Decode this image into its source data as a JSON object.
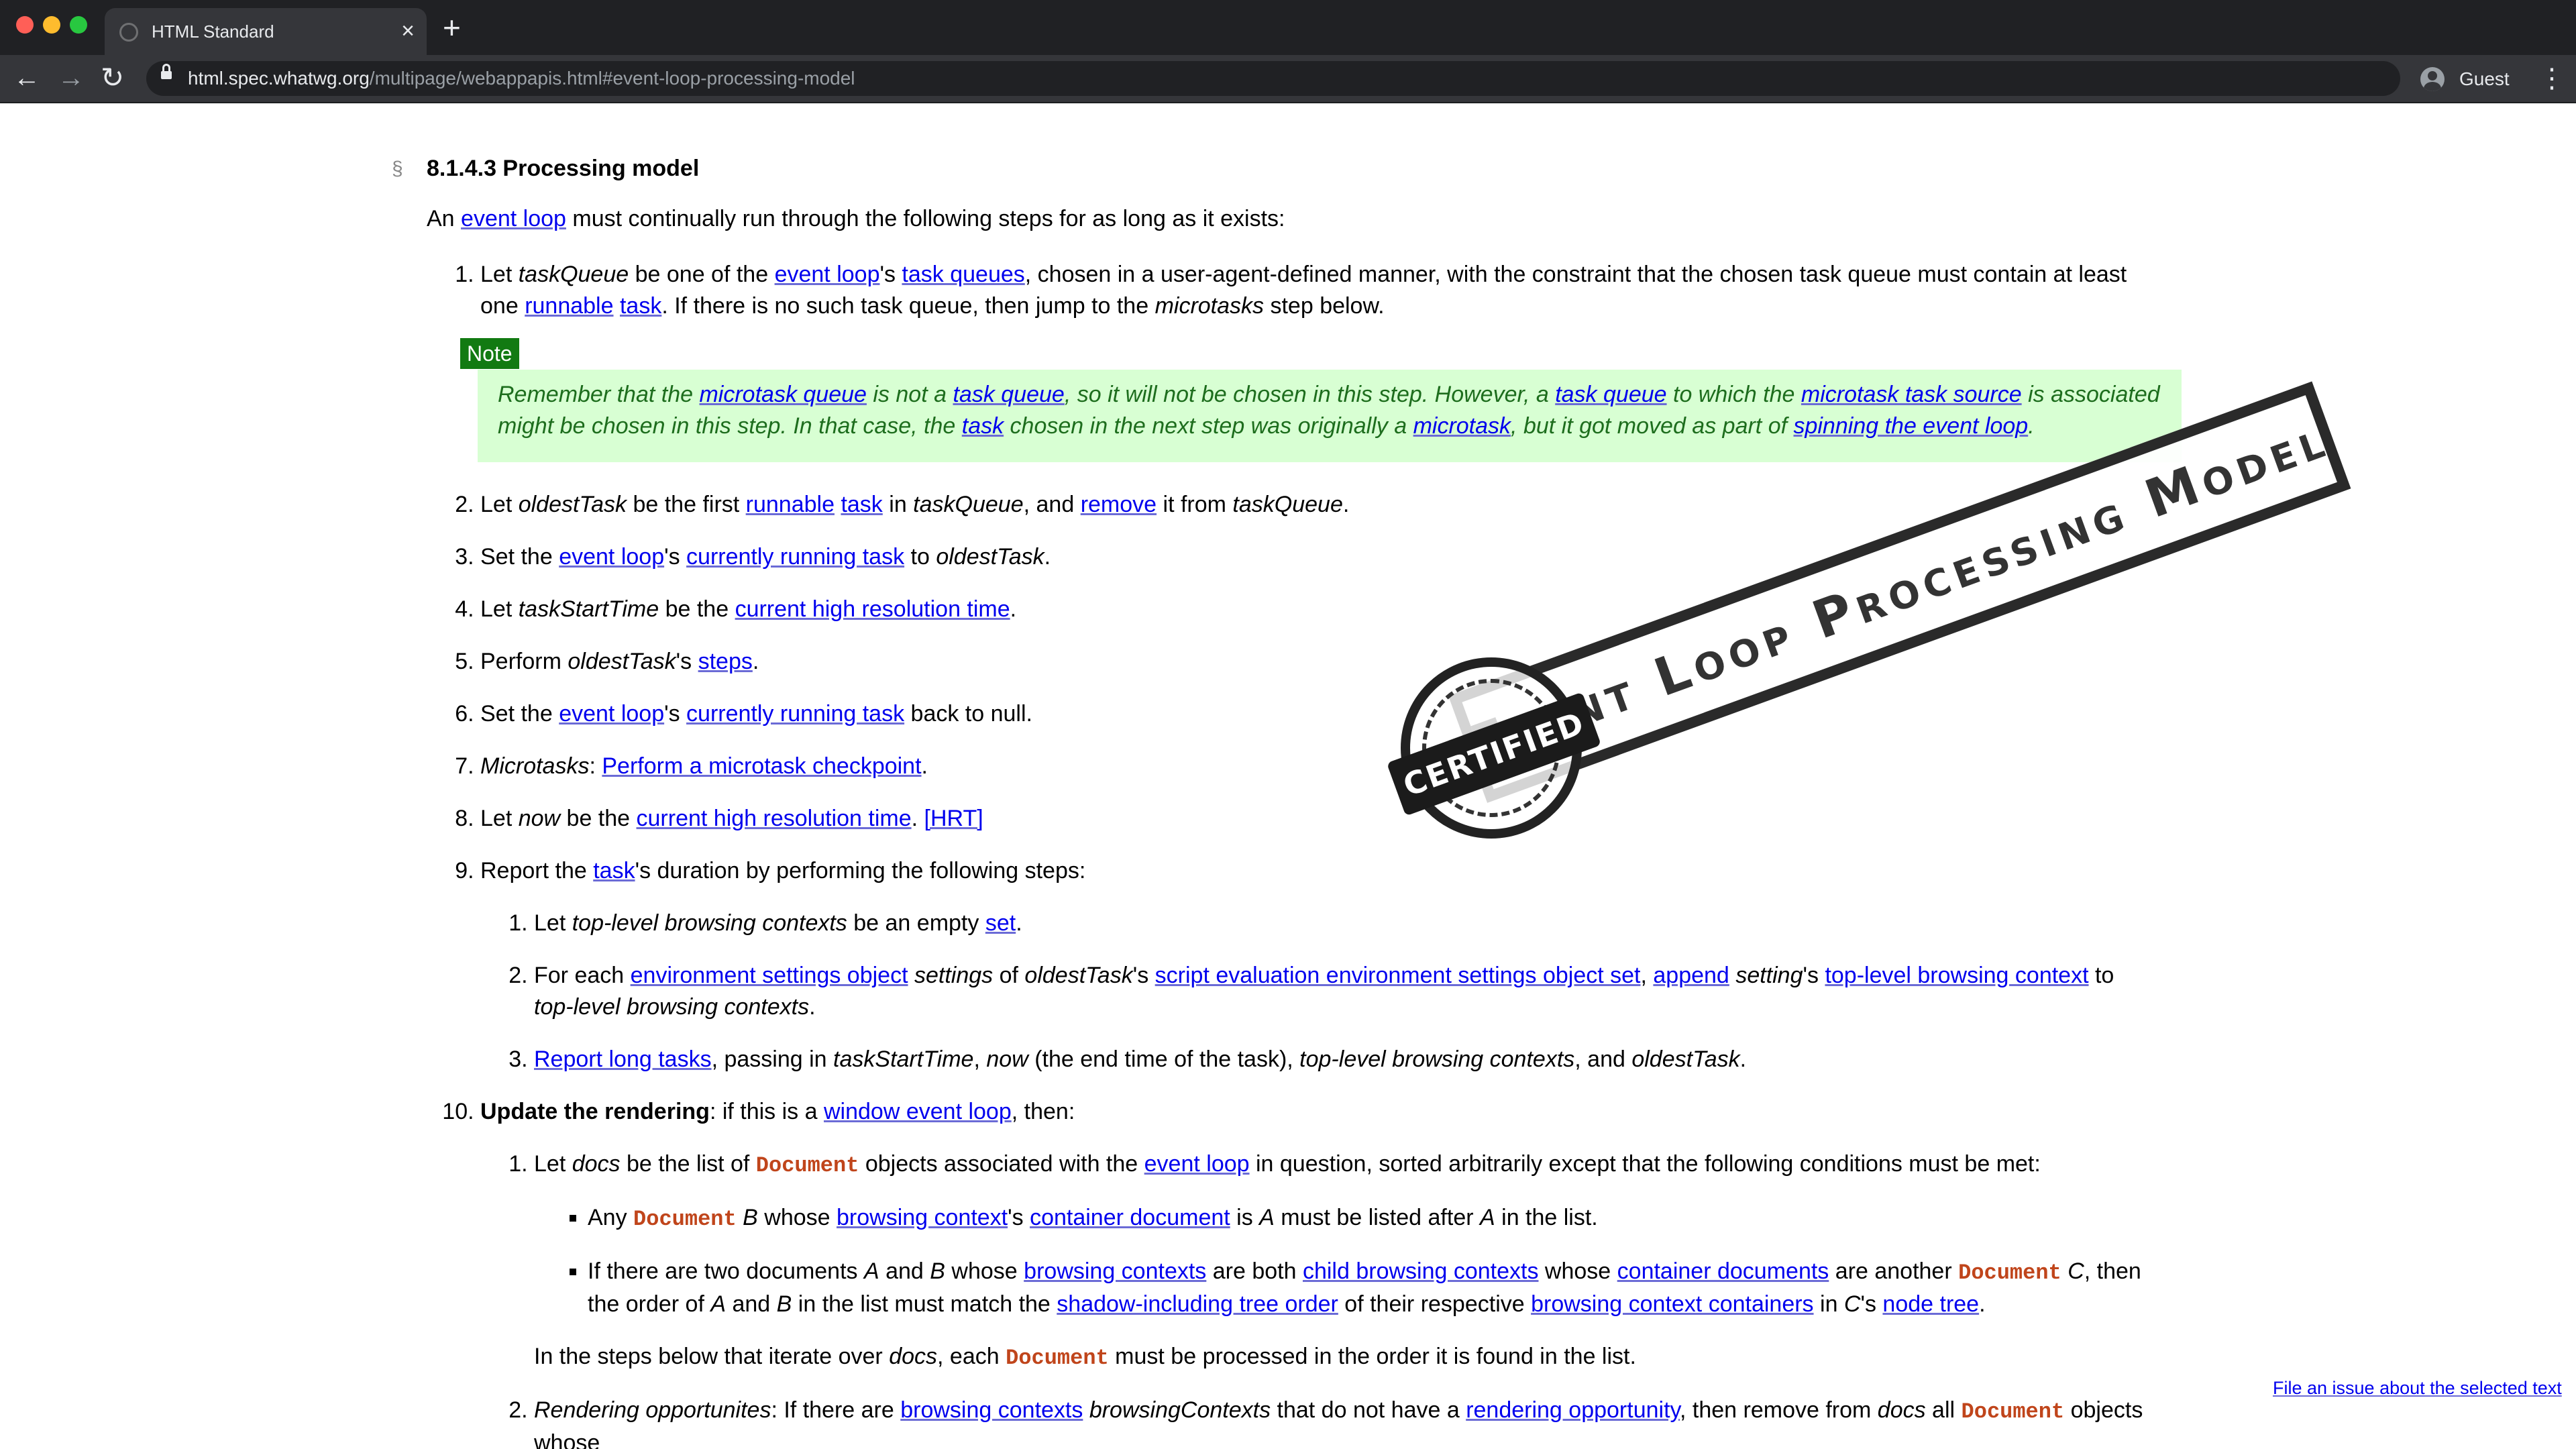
{
  "browser": {
    "tab_title": "HTML Standard",
    "tab_close": "×",
    "new_tab": "+",
    "url_host": "html.spec.whatwg.org",
    "url_path": "/multipage/webappapis.html#event-loop-processing-model",
    "profile_label": "Guest",
    "back_glyph": "←",
    "forward_glyph": "→",
    "reload_glyph": "↻",
    "menu_glyph": "⋮"
  },
  "doc": {
    "section_mark": "§",
    "heading": "8.1.4.3 Processing model",
    "intro": {
      "before": "An ",
      "link": "event loop",
      "after": " must continually run through the following steps for as long as it exists:"
    },
    "step1": {
      "t1": "Let ",
      "i1": "taskQueue",
      "t2": " be one of the ",
      "l1": "event loop",
      "t3": "'s ",
      "l2": "task queues",
      "t4": ", chosen in a user-agent-defined manner, with the constraint that the chosen task queue must contain at least one ",
      "l3": "runnable",
      "t5": " ",
      "l4": "task",
      "t6": ". If there is no such task queue, then jump to the ",
      "i2": "microtasks",
      "t7": " step below."
    },
    "note": {
      "tag": "Note",
      "t1": "Remember that the ",
      "l1": "microtask queue",
      "t2": " is not a ",
      "l2": "task queue",
      "t3": ", so it will not be chosen in this step. However, a ",
      "l3": "task queue",
      "t4": " to which the ",
      "l4": "microtask task source",
      "t5": " is associated might be chosen in this step. In that case, the ",
      "l5": "task",
      "t6": " chosen in the next step was originally a ",
      "l6": "microtask",
      "t7": ", but it got moved as part of ",
      "l7": "spinning the event loop",
      "t8": "."
    },
    "step2": {
      "t1": "Let ",
      "i1": "oldestTask",
      "t2": " be the first ",
      "l1": "runnable",
      "t3": " ",
      "l2": "task",
      "t4": " in ",
      "i2": "taskQueue",
      "t5": ", and ",
      "l3": "remove",
      "t6": " it from ",
      "i3": "taskQueue",
      "t7": "."
    },
    "step3": {
      "t1": "Set the ",
      "l1": "event loop",
      "t2": "'s ",
      "l2": "currently running task",
      "t3": " to ",
      "i1": "oldestTask",
      "t4": "."
    },
    "step4": {
      "t1": "Let ",
      "i1": "taskStartTime",
      "t2": " be the ",
      "l1": "current high resolution time",
      "t3": "."
    },
    "step5": {
      "t1": "Perform ",
      "i1": "oldestTask",
      "t2": "'s ",
      "l1": "steps",
      "t3": "."
    },
    "step6": {
      "t1": "Set the ",
      "l1": "event loop",
      "t2": "'s ",
      "l2": "currently running task",
      "t3": " back to null."
    },
    "step7": {
      "i1": "Microtasks",
      "t1": ": ",
      "l1": "Perform a microtask checkpoint",
      "t2": "."
    },
    "step8": {
      "t1": "Let ",
      "i1": "now",
      "t2": " be the ",
      "l1": "current high resolution time",
      "t3": ". ",
      "l2": "[HRT]"
    },
    "step9": {
      "t1": "Report the ",
      "l1": "task",
      "t2": "'s duration by performing the following steps:",
      "s1": {
        "t1": "Let ",
        "i1": "top-level browsing contexts",
        "t2": " be an empty ",
        "l1": "set",
        "t3": "."
      },
      "s2": {
        "t1": "For each ",
        "l1": "environment settings object",
        "t2": " ",
        "i1": "settings",
        "t3": " of ",
        "i2": "oldestTask",
        "t4": "'s ",
        "l2": "script evaluation environment settings object set",
        "t5": ", ",
        "l3": "append",
        "t6": " ",
        "i3": "setting",
        "t7": "'s ",
        "l4": "top-level browsing context",
        "t8": " to ",
        "i4": "top-level browsing contexts",
        "t9": "."
      },
      "s3": {
        "l1": "Report long tasks",
        "t1": ", passing in ",
        "i1": "taskStartTime",
        "t2": ", ",
        "i2": "now",
        "t3": " (the end time of the task), ",
        "i3": "top-level browsing contexts",
        "t4": ", and ",
        "i4": "oldestTask",
        "t5": "."
      }
    },
    "step10": {
      "b1": "Update the rendering",
      "t1": ": if this is a ",
      "l1": "window event loop",
      "t2": ", then:",
      "s1": {
        "t1": "Let ",
        "i1": "docs",
        "t2": " be the list of ",
        "k1": "Document",
        "t3": " objects associated with the ",
        "l1": "event loop",
        "t4": " in question, sorted arbitrarily except that the following conditions must be met:",
        "b1": {
          "t1": "Any ",
          "k1": "Document",
          "t2": " ",
          "i1": "B",
          "t3": " whose ",
          "l1": "browsing context",
          "t4": "'s ",
          "l2": "container document",
          "t5": " is ",
          "i2": "A",
          "t6": " must be listed after ",
          "i3": "A",
          "t7": " in the list."
        },
        "b2": {
          "t1": "If there are two documents ",
          "i1": "A",
          "t2": " and ",
          "i2": "B",
          "t3": " whose ",
          "l1": "browsing contexts",
          "t4": " are both ",
          "l2": "child browsing contexts",
          "t5": " whose ",
          "l3": "container documents",
          "t6": " are another ",
          "k1": "Document",
          "t7": " ",
          "i3": "C",
          "t8": ", then the order of ",
          "i4": "A",
          "t9": " and ",
          "i5": "B",
          "t10": " in the list must match the ",
          "l4": "shadow-including tree order",
          "t11": " of their respective ",
          "l5": "browsing context containers",
          "t12": " in ",
          "i6": "C",
          "t13": "'s ",
          "l6": "node tree",
          "t14": "."
        },
        "after": {
          "t1": "In the steps below that iterate over ",
          "i1": "docs",
          "t2": ", each ",
          "k1": "Document",
          "t3": " must be processed in the order it is found in the list."
        }
      },
      "s2": {
        "i1": "Rendering opportunites",
        "t1": ": If there are ",
        "l1": "browsing contexts",
        "t2": " ",
        "i2": "browsingContexts",
        "t3": " that do not have a ",
        "l2": "rendering opportunity",
        "t4": ", then remove from ",
        "i3": "docs",
        "t5": " all ",
        "k1": "Document",
        "t6": " objects whose"
      }
    },
    "issue_link": "File an issue about the selected text"
  },
  "stamp": {
    "seal_text": "CERTIFIED",
    "band_text": "Event Loop Processing Model"
  }
}
